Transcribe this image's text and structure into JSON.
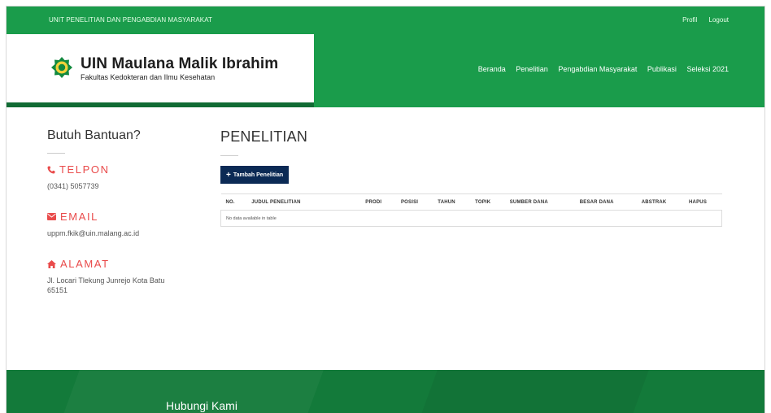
{
  "topbar": {
    "site_name": "UNIT PENELITIAN DAN PENGABDIAN MASYARAKAT",
    "links": [
      "Profil",
      "Logout"
    ]
  },
  "brand": {
    "title": "UIN Maulana Malik Ibrahim",
    "subtitle": "Fakultas Kedokteran dan Ilmu Kesehatan"
  },
  "nav": {
    "items": [
      "Beranda",
      "Penelitian",
      "Pengabdian Masyarakat",
      "Publikasi",
      "Seleksi 2021"
    ]
  },
  "sidebar": {
    "title": "Butuh Bantuan?",
    "phone_label": "TELPON",
    "phone_value": "(0341) 5057739",
    "email_label": "EMAIL",
    "email_value": "uppm.fkik@uin.malang.ac.id",
    "address_label": "ALAMAT",
    "address_value": "Jl. Locari Tlekung Junrejo Kota Batu 65151"
  },
  "main": {
    "page_title": "PENELITIAN",
    "add_button": "Tambah Penelitian",
    "table_headers": [
      "NO.",
      "JUDUL PENELITIAN",
      "PRODI",
      "POSISI",
      "TAHUN",
      "TOPIK",
      "SUMBER DANA",
      "BESAR DANA",
      "ABSTRAK",
      "HAPUS"
    ],
    "empty_message": "No data available in table"
  },
  "footer": {
    "title": "Hubungi Kami"
  },
  "colors": {
    "brand_green": "#1a9c4b",
    "dark_green": "#116b34",
    "accent_red": "#e94b4b",
    "button_navy": "#0b2a55"
  },
  "icons": {
    "phone": "phone-icon",
    "email": "envelope-icon",
    "address": "home-icon",
    "add": "plus-icon",
    "logo": "uin-logo-icon"
  }
}
